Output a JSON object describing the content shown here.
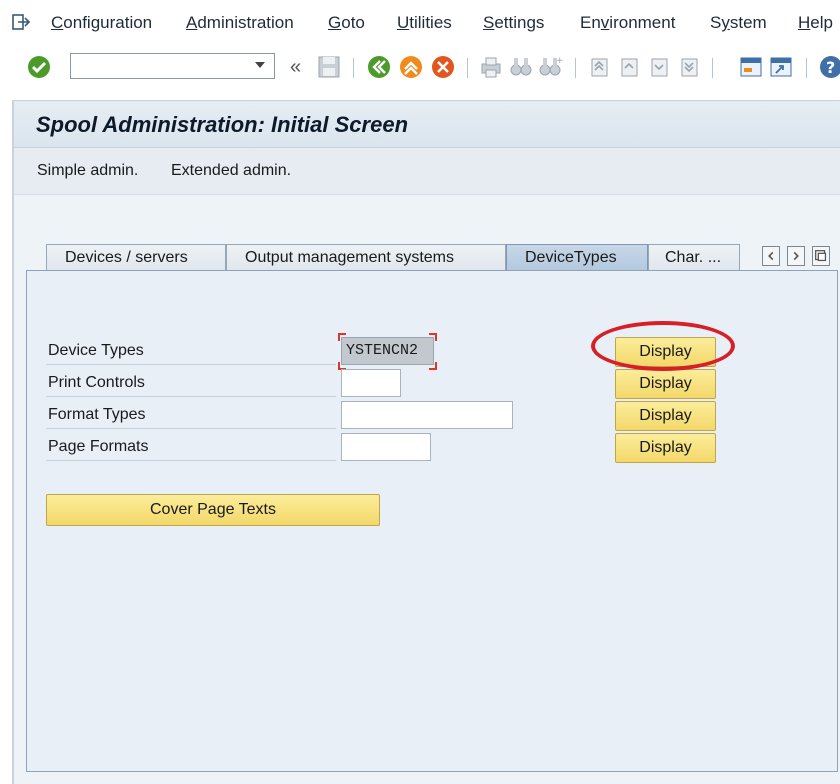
{
  "menu": {
    "items": [
      {
        "pre": "",
        "ul": "C",
        "post": "onfiguration"
      },
      {
        "pre": "",
        "ul": "A",
        "post": "dministration"
      },
      {
        "pre": "",
        "ul": "G",
        "post": "oto"
      },
      {
        "pre": "",
        "ul": "U",
        "post": "tilities"
      },
      {
        "pre": "",
        "ul": "S",
        "post": "ettings"
      },
      {
        "pre": "En",
        "ul": "v",
        "post": "ironment"
      },
      {
        "pre": "S",
        "ul": "y",
        "post": "stem"
      },
      {
        "pre": "",
        "ul": "H",
        "post": "elp"
      }
    ]
  },
  "toolbar": {
    "command_value": "",
    "back_chevron": "«",
    "icons": [
      "enter-icon",
      "save-icon",
      "back-icon",
      "exit-icon",
      "cancel-icon",
      "print-icon",
      "find-icon",
      "find-next-icon",
      "first-page-icon",
      "previous-page-icon",
      "next-page-icon",
      "last-page-icon",
      "create-session-icon",
      "shortcut-icon",
      "help-icon"
    ]
  },
  "title": "Spool Administration: Initial Screen",
  "appbar": {
    "simple": "Simple admin.",
    "extended": "Extended admin."
  },
  "tabs": [
    {
      "label": "Devices / servers",
      "active": false
    },
    {
      "label": "Output management systems",
      "active": false
    },
    {
      "label": "DeviceTypes",
      "active": true
    },
    {
      "label": "Char. ...",
      "active": false
    }
  ],
  "form": {
    "rows": [
      {
        "label": "Device Types",
        "value": "YSTENCN2",
        "button": "Display"
      },
      {
        "label": "Print Controls",
        "value": "",
        "button": "Display"
      },
      {
        "label": "Format Types",
        "value": "",
        "button": "Display"
      },
      {
        "label": "Page Formats",
        "value": "",
        "button": "Display"
      }
    ],
    "cover_button": "Cover Page Texts"
  },
  "colors": {
    "accent_button": "#f3d86a",
    "highlight_circle": "#d61f26",
    "active_tab": "#b3c8de"
  }
}
